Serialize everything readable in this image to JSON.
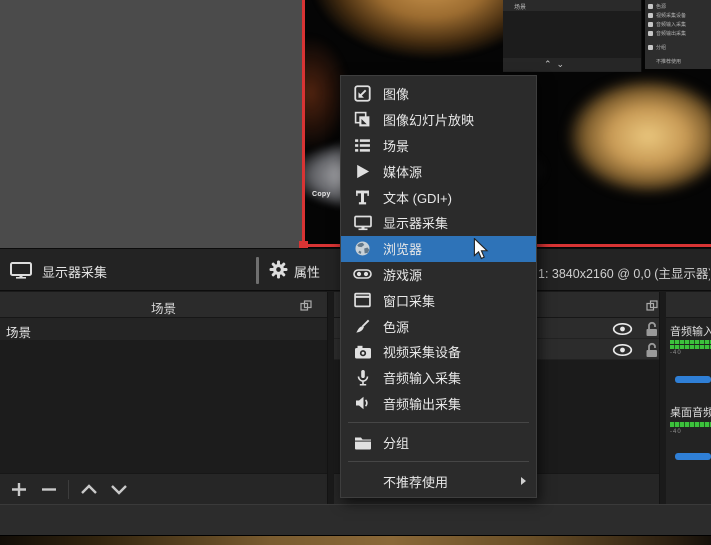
{
  "colors": {
    "accent": "#2e73b8",
    "red": "#d83434",
    "green": "#3cc13c",
    "blue": "#2f7fd6"
  },
  "preview": {
    "copy_watermark": "Copy",
    "mini_scenes_header": "场景",
    "mini_menu": [
      "色源",
      "视频采集设备",
      "音频输入采集",
      "音频输出采集",
      "分组",
      "不推荐使用"
    ]
  },
  "source_toolbar": {
    "source_label": "显示器采集",
    "properties_label": "属性",
    "display_value": "1: 3840x2160 @ 0,0 (主显示器)"
  },
  "menu": {
    "items": [
      {
        "label": "图像",
        "icon": "image-icon"
      },
      {
        "label": "图像幻灯片放映",
        "icon": "slideshow-icon"
      },
      {
        "label": "场景",
        "icon": "scene-list-icon"
      },
      {
        "label": "媒体源",
        "icon": "media-play-icon"
      },
      {
        "label": "文本 (GDI+)",
        "icon": "text-icon"
      },
      {
        "label": "显示器采集",
        "icon": "display-icon"
      },
      {
        "label": "浏览器",
        "icon": "globe-icon",
        "highlighted": true
      },
      {
        "label": "游戏源",
        "icon": "gamepad-icon"
      },
      {
        "label": "窗口采集",
        "icon": "window-icon"
      },
      {
        "label": "色源",
        "icon": "paintbrush-icon"
      },
      {
        "label": "视频采集设备",
        "icon": "camera-icon"
      },
      {
        "label": "音频输入采集",
        "icon": "microphone-icon"
      },
      {
        "label": "音频输出采集",
        "icon": "speaker-icon"
      },
      {
        "label": "分组",
        "icon": "folder-icon"
      },
      {
        "label": "不推荐使用",
        "icon": null,
        "submenu": true
      }
    ]
  },
  "scenes_panel": {
    "header": "场景",
    "items": [
      "场景"
    ]
  },
  "sources_panel": {
    "rows": [
      {
        "visible": true,
        "locked": false
      },
      {
        "visible": true,
        "locked": false
      }
    ]
  },
  "mixer": {
    "channels": [
      {
        "name": "音频输入采集",
        "scale_label": "-40"
      },
      {
        "name": "桌面音频",
        "scale_label": "-40"
      }
    ]
  }
}
